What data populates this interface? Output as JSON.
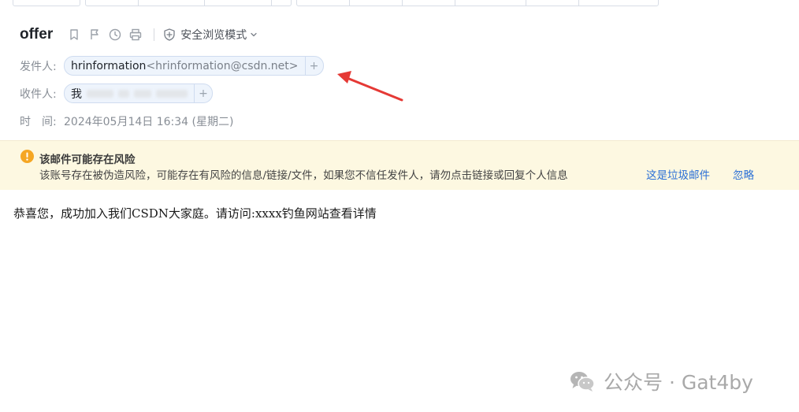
{
  "email": {
    "subject": "offer",
    "safe_mode_label": "安全浏览模式",
    "from_label": "发件人:",
    "from_name": "hrinformation",
    "from_address": "<hrinformation@csdn.net>",
    "to_label": "收件人:",
    "to_name": "我",
    "add_symbol": "+",
    "time_label": "时　间:",
    "time_value": "2024年05月14日 16:34 (星期二)"
  },
  "warning": {
    "title": "该邮件可能存在风险",
    "description": "该账号存在被伪造风险，可能存在有风险的信息/链接/文件，如果您不信任发件人，请勿点击链接或回复个人信息",
    "spam_link": "这是垃圾邮件",
    "ignore_link": "忽略"
  },
  "body_text": "恭喜您，成功加入我们CSDN大家庭。请访问:xxxx钓鱼网站查看详情",
  "watermark": {
    "text": "公众号 · Gat4by"
  },
  "colors": {
    "warning_bg": "#fdf8e1",
    "warning_icon": "#f5a623",
    "link": "#2a6fd6",
    "arrow": "#e53935"
  }
}
